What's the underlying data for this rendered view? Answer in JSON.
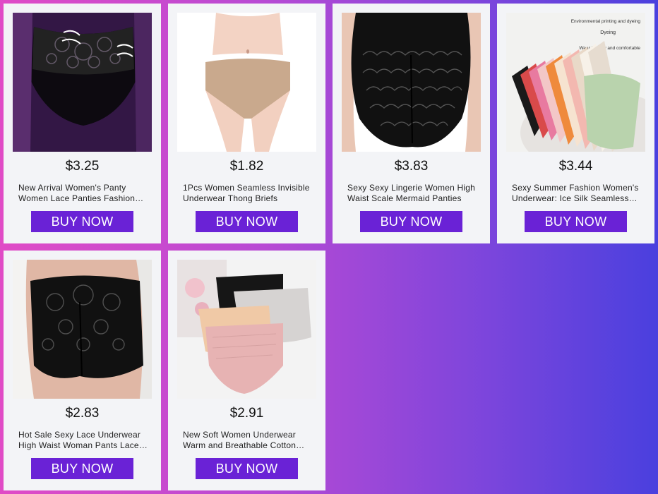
{
  "products": [
    {
      "price": "$3.25",
      "title": "New Arrival Women's Panty Women Lace Panties Fashion Breathable Underwear",
      "button": "BUY NOW",
      "image_icon": "lace-panty-photo"
    },
    {
      "price": "$1.82",
      "title": "1Pcs Women Seamless Invisible Underwear Thong Briefs",
      "button": "BUY NOW",
      "image_icon": "seamless-brief-photo"
    },
    {
      "price": "$3.83",
      "title": "Sexy Sexy Lingerie Women High Waist Scale Mermaid Panties",
      "button": "BUY NOW",
      "image_icon": "mermaid-scale-panty-photo"
    },
    {
      "price": "$3.44",
      "title": "Sexy Summer Fashion Women's Underwear: Ice Silk Seamless Panties",
      "button": "BUY NOW",
      "image_icon": "ice-silk-panties-photo",
      "image_texts": [
        "Environmental printing and dyeing",
        "Dyeing",
        "Wear healthy and comfortable"
      ]
    },
    {
      "price": "$2.83",
      "title": "Hot Sale Sexy Lace Underwear High Waist Woman Pants Lace Briefs",
      "button": "BUY NOW",
      "image_icon": "high-waist-lace-photo"
    },
    {
      "price": "$2.91",
      "title": "New Soft Women Underwear Warm and Breathable Cotton Briefs",
      "button": "BUY NOW",
      "image_icon": "folded-panties-photo"
    }
  ],
  "colors": {
    "button": "#6a22d6",
    "card": "#f3f4f7",
    "bg_left": "#e04bc6",
    "bg_right": "#4a40de"
  }
}
